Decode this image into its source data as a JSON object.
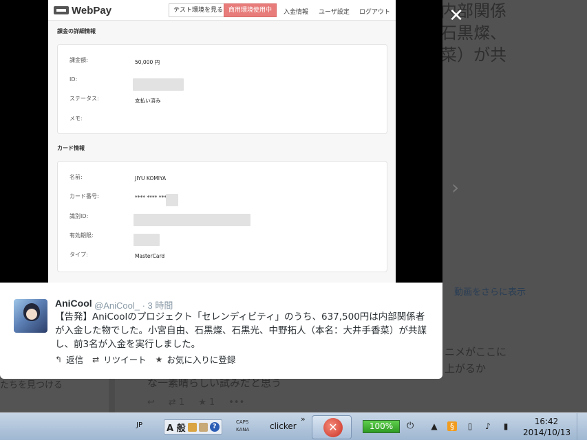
{
  "background": {
    "headline_lines": [
      "内部関係",
      "石黒燦、",
      "菜）が共"
    ],
    "side_link": "動画をさらに表示",
    "body_lines": [
      "ニメがここに",
      "上がるか"
    ],
    "body_line_bottom": "な一素晴らしい試みだと思う",
    "left_link": "たちを見つける",
    "actions": [
      "↩",
      "⇄ 1",
      "★ 1",
      "•••"
    ],
    "next_icon": "chevron-right-icon"
  },
  "modal": {
    "close_icon": "✕",
    "screenshot": {
      "logo_text": "WebPay",
      "test_env_label": "テスト環境を見る",
      "prod_env_label": "商用環境使用中",
      "nav": [
        "入金情報",
        "ユーザ設定",
        "ログアウト"
      ],
      "charge_section_title": "課金の詳細情報",
      "charge_fields": [
        {
          "label": "課金額:",
          "value": "50,000 円"
        },
        {
          "label": "ID:",
          "value": ""
        },
        {
          "label": "ステータス:",
          "value": "支払い済み"
        },
        {
          "label": "メモ:",
          "value": ""
        }
      ],
      "card_section_title": "カード情報",
      "card_fields": [
        {
          "label": "名前:",
          "value": "JIYU KOMIYA"
        },
        {
          "label": "カード番号:",
          "value": "**** **** ****"
        },
        {
          "label": "識別ID:",
          "value": ""
        },
        {
          "label": "有効期限:",
          "value": ""
        },
        {
          "label": "タイプ:",
          "value": "MasterCard"
        }
      ]
    },
    "tweet": {
      "name": "AniCool",
      "handle": "@AniCool_",
      "time": "· 3 時間",
      "text": "【告発】AniCoolのプロジェクト「セレンディビティ」のうち、637,500円は内部関係者が入金した物でした。小宮自由、石黒燦、石黒光、中野拓人（本名：大井手香菜）が共謀し、前3名が入金を実行しました。",
      "actions": [
        {
          "icon": "↰",
          "label": "返信"
        },
        {
          "icon": "⇄",
          "label": "リツイート"
        },
        {
          "icon": "★",
          "label": "お気に入りに登録"
        }
      ]
    }
  },
  "taskbar": {
    "language": "JP",
    "ime_mode": "A 般",
    "caps": "CAPS",
    "kana": "KANA",
    "app_label": "clicker",
    "overflow": "»",
    "battery": "100%",
    "time": "16:42",
    "date": "2014/10/13"
  }
}
